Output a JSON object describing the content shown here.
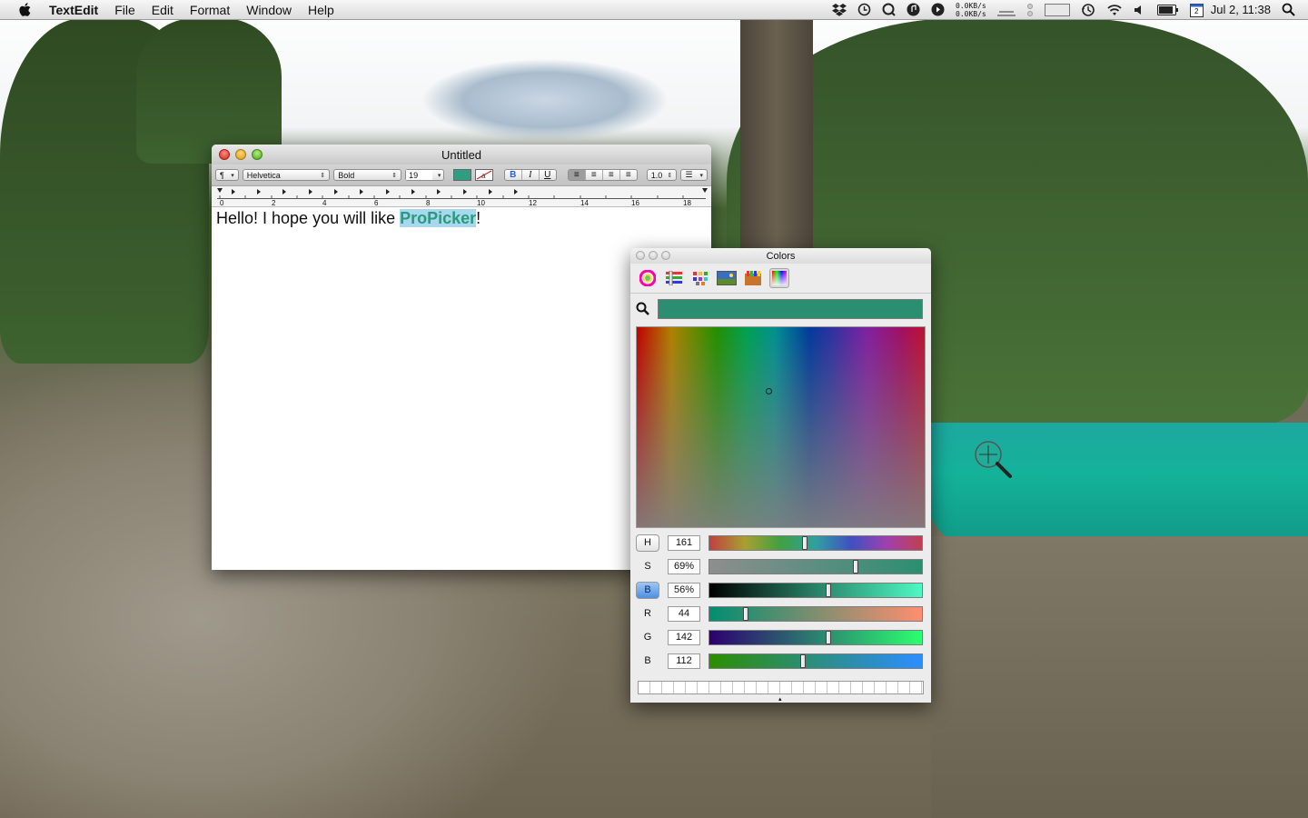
{
  "menubar": {
    "app_name": "TextEdit",
    "menus": [
      "File",
      "Edit",
      "Format",
      "Window",
      "Help"
    ],
    "net_up": "0.0KB/s",
    "net_down": "0.0KB/s",
    "calendar_day": "2",
    "clock": "Jul 2, 11:38"
  },
  "textedit": {
    "title": "Untitled",
    "paragraph_style": "¶",
    "font_family": "Helvetica",
    "font_style": "Bold",
    "font_size": "19",
    "text_color": "#2f9e80",
    "bold": "B",
    "italic": "I",
    "underline": "U",
    "line_spacing": "1.0",
    "ruler_numbers": [
      "0",
      "2",
      "4",
      "6",
      "8",
      "10",
      "12",
      "14",
      "16",
      "18"
    ],
    "body_prefix": "Hello! I hope you will like ",
    "body_highlight": "ProPicker",
    "body_suffix": "!"
  },
  "colors_panel": {
    "title": "Colors",
    "current_color": "#2c8e70",
    "modes": [
      "color-wheel",
      "color-sliders",
      "color-palettes",
      "image-palettes",
      "crayons",
      "spectrum"
    ],
    "selected_mode": "spectrum",
    "sliders": [
      {
        "label": "H",
        "value": "161",
        "fraction": 0.45
      },
      {
        "label": "S",
        "value": "69%",
        "fraction": 0.69
      },
      {
        "label": "B",
        "value": "56%",
        "fraction": 0.56
      },
      {
        "label": "R",
        "value": "44",
        "fraction": 0.17
      },
      {
        "label": "G",
        "value": "142",
        "fraction": 0.56
      },
      {
        "label": "B",
        "value": "112",
        "fraction": 0.44
      }
    ]
  }
}
